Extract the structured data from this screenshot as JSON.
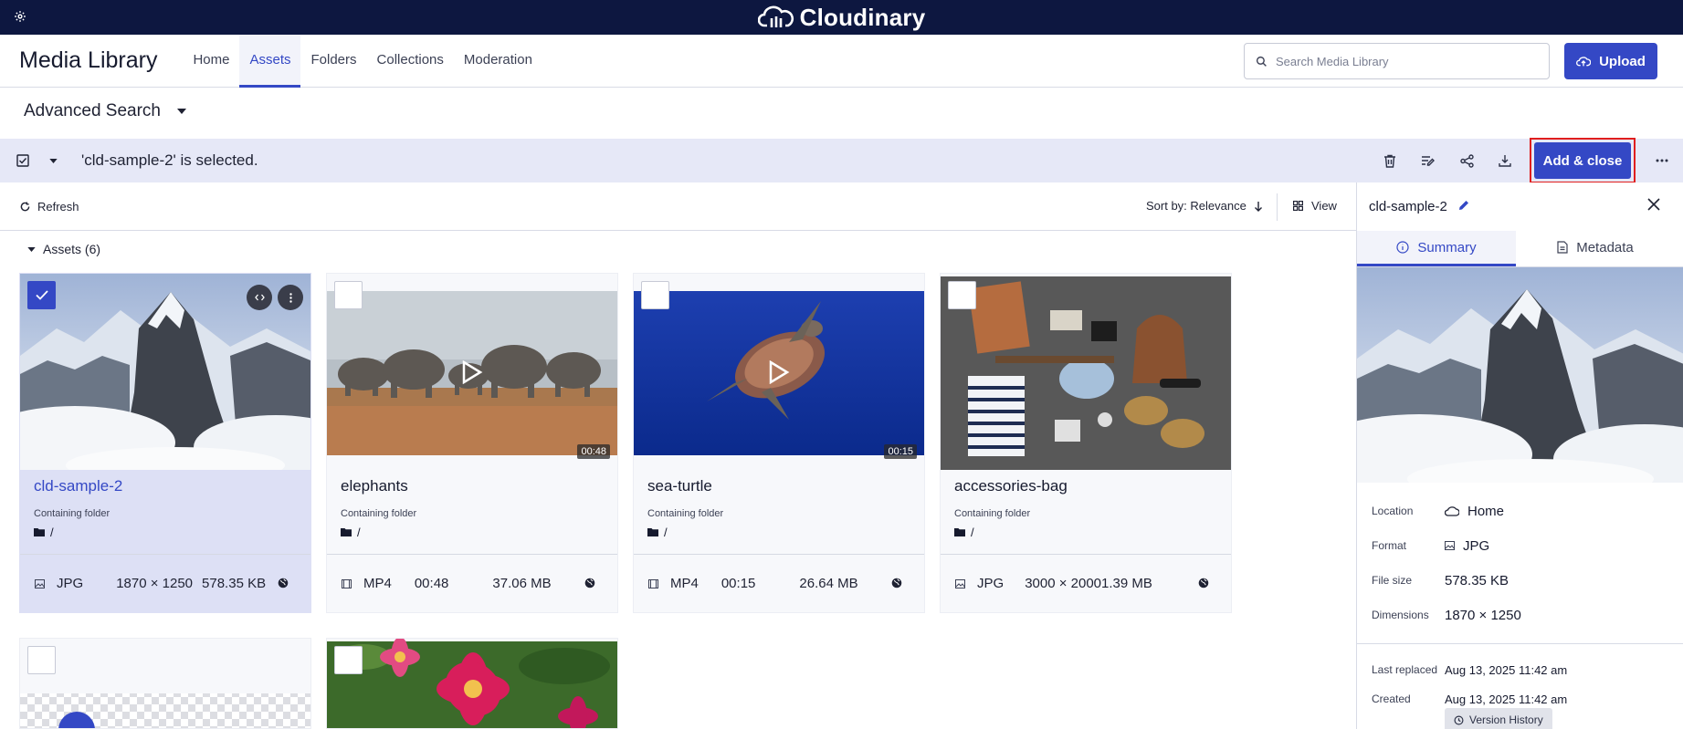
{
  "brand": {
    "name": "Cloudinary"
  },
  "header": {
    "app_title": "Media Library",
    "tabs": [
      {
        "label": "Home",
        "active": false
      },
      {
        "label": "Assets",
        "active": true
      },
      {
        "label": "Folders",
        "active": false
      },
      {
        "label": "Collections",
        "active": false
      },
      {
        "label": "Moderation",
        "active": false
      }
    ],
    "search_placeholder": "Search Media Library",
    "upload_label": "Upload"
  },
  "advanced_search": {
    "label": "Advanced Search"
  },
  "selection_bar": {
    "text": "'cld-sample-2' is selected.",
    "add_close_label": "Add & close",
    "actions": [
      "trash-icon",
      "edit-list-icon",
      "share-icon",
      "download-icon"
    ]
  },
  "toolbar": {
    "refresh_label": "Refresh",
    "sort_label": "Sort by: Relevance",
    "view_label": "View"
  },
  "assets_section": {
    "label": "Assets (6)"
  },
  "assets": [
    {
      "name": "cld-sample-2",
      "folder_label": "Containing folder",
      "folder": "/",
      "format": "JPG",
      "dims": "1870 × 1250",
      "size": "578.35 KB",
      "selected": true,
      "type": "image"
    },
    {
      "name": "elephants",
      "folder_label": "Containing folder",
      "folder": "/",
      "format": "MP4",
      "dims": "00:48",
      "size": "37.06 MB",
      "selected": false,
      "type": "video",
      "duration": "00:48"
    },
    {
      "name": "sea-turtle",
      "folder_label": "Containing folder",
      "folder": "/",
      "format": "MP4",
      "dims": "00:15",
      "size": "26.64 MB",
      "selected": false,
      "type": "video",
      "duration": "00:15"
    },
    {
      "name": "accessories-bag",
      "folder_label": "Containing folder",
      "folder": "/",
      "format": "JPG",
      "dims": "3000 × 2000",
      "size": "1.39 MB",
      "selected": false,
      "type": "image"
    }
  ],
  "panel": {
    "title": "cld-sample-2",
    "tabs": [
      {
        "label": "Summary",
        "active": true
      },
      {
        "label": "Metadata",
        "active": false
      }
    ],
    "props": {
      "location_label": "Location",
      "location": "Home",
      "format_label": "Format",
      "format": "JPG",
      "size_label": "File size",
      "size": "578.35 KB",
      "dims_label": "Dimensions",
      "dims": "1870 × 1250",
      "replaced_label": "Last replaced",
      "replaced": "Aug 13, 2025 11:42 am",
      "created_label": "Created",
      "created": "Aug 13, 2025 11:42 am"
    },
    "version_history_label": "Version History"
  },
  "colors": {
    "brand_bar": "#0d1740",
    "accent": "#3448c5",
    "highlight_border": "#e01e1e",
    "selection_bg": "#e6e8f7"
  }
}
